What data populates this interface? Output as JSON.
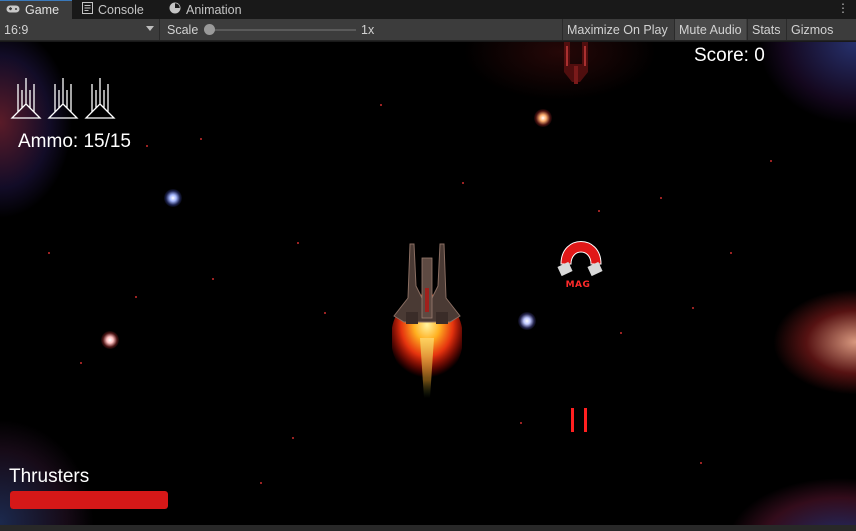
{
  "tabs": [
    {
      "label": "Game",
      "icon": "gamepad-icon",
      "active": true
    },
    {
      "label": "Console",
      "icon": "console-icon",
      "active": false
    },
    {
      "label": "Animation",
      "icon": "animation-icon",
      "active": false
    }
  ],
  "toolbar": {
    "aspect": "16:9",
    "scale_label": "Scale",
    "scale_value": "1x",
    "maximize": "Maximize On Play",
    "mute": "Mute Audio",
    "stats": "Stats",
    "gizmos": "Gizmos"
  },
  "hud": {
    "score": "Score: 0",
    "ammo": "Ammo: 15/15",
    "thrusters_label": "Thrusters",
    "thrusters_level": 1.0,
    "lives": 3
  },
  "powerup": {
    "label": "MAG"
  },
  "colors": {
    "thruster": "#d51818",
    "tab_accent": "#3a79bb",
    "hud_text": "#ffffff"
  }
}
